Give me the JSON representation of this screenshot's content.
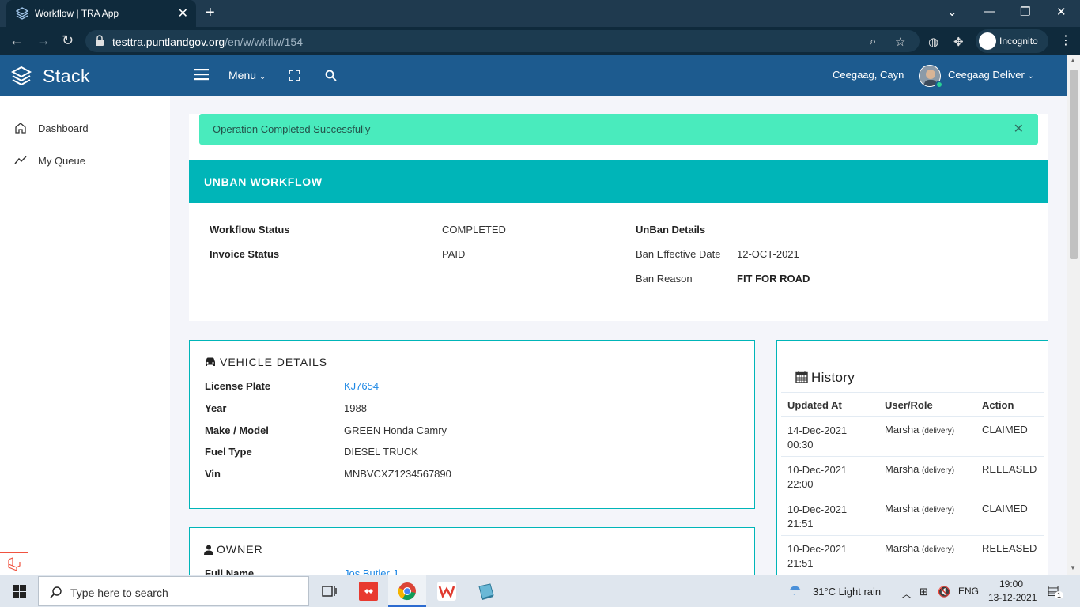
{
  "browser": {
    "tab_title": "Workflow | TRA App",
    "url_host": "testtra.puntlandgov.org",
    "url_path": "/en/w/wkflw/154",
    "incognito_label": "Incognito"
  },
  "header": {
    "brand": "Stack",
    "menu_label": "Menu",
    "user_name": "Ceegaag, Cayn",
    "role_name": "Ceegaag Deliver"
  },
  "sidebar": {
    "items": [
      {
        "label": "Dashboard",
        "icon": "home-icon"
      },
      {
        "label": "My Queue",
        "icon": "trend-line-icon"
      }
    ]
  },
  "alert": {
    "text": "Operation Completed Successfully",
    "color": "#49ebbd"
  },
  "workflow": {
    "title": "UNBAN WORKFLOW",
    "status_label": "Workflow Status",
    "status_value": "COMPLETED",
    "invoice_label": "Invoice Status",
    "invoice_value": "PAID",
    "details_label": "UnBan Details",
    "ban_date_label": "Ban Effective Date",
    "ban_date_value": "12-OCT-2021",
    "ban_reason_label": "Ban Reason",
    "ban_reason_value": "FIT FOR ROAD"
  },
  "vehicle": {
    "title": "VEHICLE DETAILS",
    "rows": [
      {
        "label": "License Plate",
        "value": "KJ7654"
      },
      {
        "label": "Year",
        "value": "1988"
      },
      {
        "label": "Make / Model",
        "value": "GREEN Honda Camry"
      },
      {
        "label": "Fuel Type",
        "value": "DIESEL TRUCK"
      },
      {
        "label": "Vin",
        "value": "MNBVCXZ1234567890"
      }
    ]
  },
  "owner": {
    "title": "OWNER",
    "full_name_label": "Full Name",
    "full_name_value": "Jos Butler J"
  },
  "history": {
    "title": "History",
    "columns": [
      "Updated At",
      "User/Role",
      "Action"
    ],
    "rows": [
      {
        "date": "14-Dec-2021",
        "time": "00:30",
        "user": "Marsha",
        "role": "(delivery)",
        "action": "CLAIMED"
      },
      {
        "date": "10-Dec-2021",
        "time": "22:00",
        "user": "Marsha",
        "role": "(delivery)",
        "action": "RELEASED"
      },
      {
        "date": "10-Dec-2021",
        "time": "21:51",
        "user": "Marsha",
        "role": "(delivery)",
        "action": "CLAIMED"
      },
      {
        "date": "10-Dec-2021",
        "time": "21:51",
        "user": "Marsha",
        "role": "(delivery)",
        "action": "RELEASED"
      }
    ]
  },
  "taskbar": {
    "search_placeholder": "Type here to search",
    "weather": "31°C  Light rain",
    "lang": "ENG",
    "time": "19:00",
    "date": "13-12-2021",
    "notifications": "1"
  }
}
